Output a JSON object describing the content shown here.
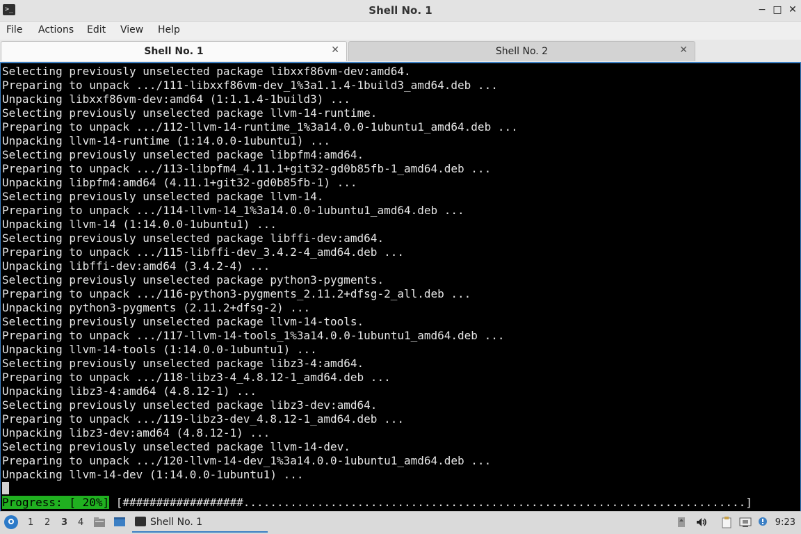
{
  "window": {
    "title": "Shell No. 1",
    "buttons": {
      "minimize": "−",
      "maximize": "□",
      "close": "✕"
    }
  },
  "menu": [
    "File",
    "Actions",
    "Edit",
    "View",
    "Help"
  ],
  "tabs": [
    {
      "label": "Shell No. 1",
      "active": true
    },
    {
      "label": "Shell No. 2",
      "active": false
    }
  ],
  "terminal": {
    "lines": [
      "Selecting previously unselected package libxxf86vm-dev:amd64.",
      "Preparing to unpack .../111-libxxf86vm-dev_1%3a1.1.4-1build3_amd64.deb ...",
      "Unpacking libxxf86vm-dev:amd64 (1:1.1.4-1build3) ...",
      "Selecting previously unselected package llvm-14-runtime.",
      "Preparing to unpack .../112-llvm-14-runtime_1%3a14.0.0-1ubuntu1_amd64.deb ...",
      "Unpacking llvm-14-runtime (1:14.0.0-1ubuntu1) ...",
      "Selecting previously unselected package libpfm4:amd64.",
      "Preparing to unpack .../113-libpfm4_4.11.1+git32-gd0b85fb-1_amd64.deb ...",
      "Unpacking libpfm4:amd64 (4.11.1+git32-gd0b85fb-1) ...",
      "Selecting previously unselected package llvm-14.",
      "Preparing to unpack .../114-llvm-14_1%3a14.0.0-1ubuntu1_amd64.deb ...",
      "Unpacking llvm-14 (1:14.0.0-1ubuntu1) ...",
      "Selecting previously unselected package libffi-dev:amd64.",
      "Preparing to unpack .../115-libffi-dev_3.4.2-4_amd64.deb ...",
      "Unpacking libffi-dev:amd64 (3.4.2-4) ...",
      "Selecting previously unselected package python3-pygments.",
      "Preparing to unpack .../116-python3-pygments_2.11.2+dfsg-2_all.deb ...",
      "Unpacking python3-pygments (2.11.2+dfsg-2) ...",
      "Selecting previously unselected package llvm-14-tools.",
      "Preparing to unpack .../117-llvm-14-tools_1%3a14.0.0-1ubuntu1_amd64.deb ...",
      "Unpacking llvm-14-tools (1:14.0.0-1ubuntu1) ...",
      "Selecting previously unselected package libz3-4:amd64.",
      "Preparing to unpack .../118-libz3-4_4.8.12-1_amd64.deb ...",
      "Unpacking libz3-4:amd64 (4.8.12-1) ...",
      "Selecting previously unselected package libz3-dev:amd64.",
      "Preparing to unpack .../119-libz3-dev_4.8.12-1_amd64.deb ...",
      "Unpacking libz3-dev:amd64 (4.8.12-1) ...",
      "Selecting previously unselected package llvm-14-dev.",
      "Preparing to unpack .../120-llvm-14-dev_1%3a14.0.0-1ubuntu1_amd64.deb ...",
      "Unpacking llvm-14-dev (1:14.0.0-1ubuntu1) ..."
    ],
    "progress_label": "Progress: [ 20%]",
    "progress_bar": "[##################...........................................................................]",
    "progress_fraction": 0.2
  },
  "taskbar": {
    "workspaces": [
      "1",
      "2",
      "3",
      "4"
    ],
    "current_workspace": "3",
    "task_label": "Shell No. 1",
    "tray_icons": [
      "storage-icon",
      "volume-icon",
      "clipboard-icon",
      "network-icon",
      "notification-icon"
    ],
    "clock": "9:23"
  },
  "colors": {
    "accent": "#3b7fc4",
    "progress_green": "#20b020",
    "terminal_bg": "#000000",
    "terminal_fg": "#e6e6e6"
  }
}
